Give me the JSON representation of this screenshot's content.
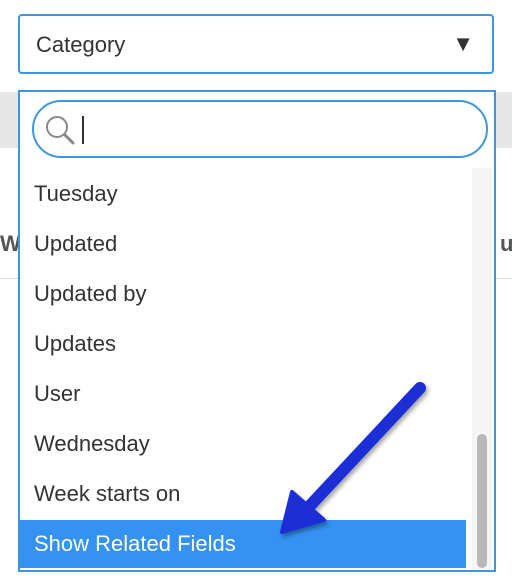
{
  "select": {
    "value": "Category"
  },
  "search": {
    "value": ""
  },
  "background": {
    "left_fragment": "W",
    "right_fragment": "u"
  },
  "options": [
    {
      "label": "Tuesday"
    },
    {
      "label": "Updated"
    },
    {
      "label": "Updated by"
    },
    {
      "label": "Updates"
    },
    {
      "label": "User"
    },
    {
      "label": "Wednesday"
    },
    {
      "label": "Week starts on"
    },
    {
      "label": "Show Related Fields"
    }
  ],
  "colors": {
    "accent": "#3d97e0",
    "highlight": "#3392f2",
    "arrow": "#1a2ed6"
  },
  "icons": {
    "caret": "▼",
    "search": "magnifier-icon"
  }
}
